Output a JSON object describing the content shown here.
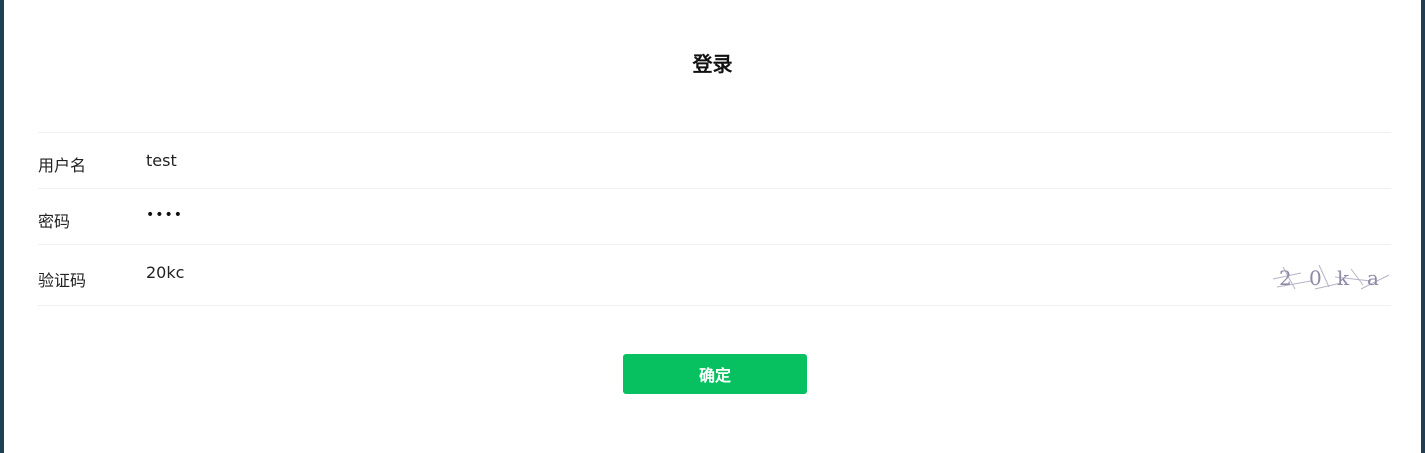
{
  "page": {
    "title": "登录"
  },
  "form": {
    "username": {
      "label": "用户名",
      "value": "test"
    },
    "password": {
      "label": "密码",
      "masked_value": "••••"
    },
    "captcha": {
      "label": "验证码",
      "value": "20kc",
      "image_text": "2 0 k a"
    }
  },
  "actions": {
    "submit_label": "确定"
  },
  "colors": {
    "primary": "#07c160",
    "window_border": "#1f3f54"
  }
}
